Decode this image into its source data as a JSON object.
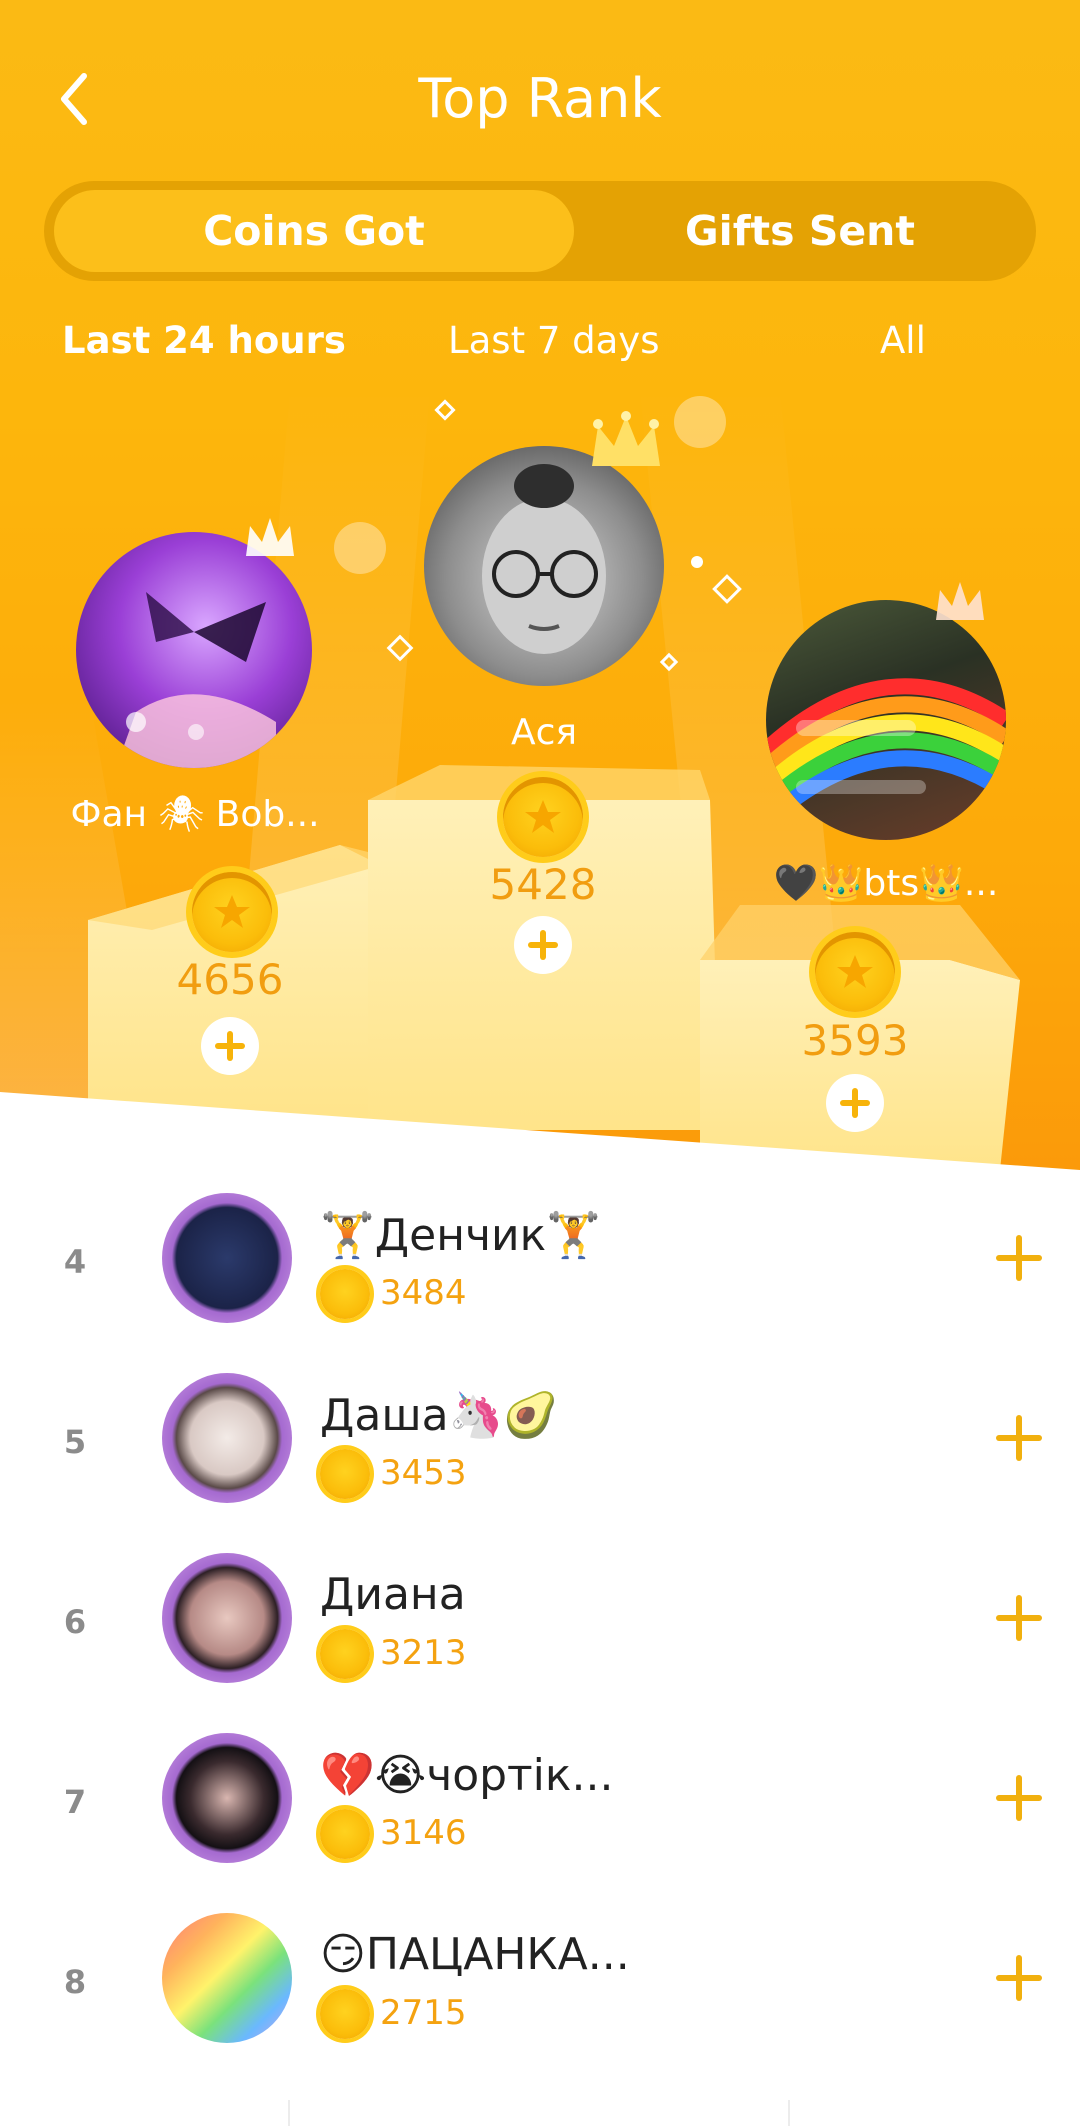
{
  "header": {
    "title": "Top Rank",
    "back_icon": "chevron-left-icon"
  },
  "segments": [
    {
      "label": "Coins Got",
      "active": true
    },
    {
      "label": "Gifts Sent",
      "active": false
    }
  ],
  "periods": [
    {
      "label": "Last 24 hours",
      "active": true
    },
    {
      "label": "Last 7 days",
      "active": false
    },
    {
      "label": "All",
      "active": false
    }
  ],
  "podium": {
    "first": {
      "name": "Ася",
      "score": "5428"
    },
    "second": {
      "name": "Фан 🕷 Bob...",
      "score": "4656"
    },
    "third": {
      "name": "🖤👑bts👑...",
      "score": "3593"
    }
  },
  "list": [
    {
      "rank": "4",
      "name": "🏋️Денчик🏋️",
      "score": "3484"
    },
    {
      "rank": "5",
      "name": "Даша🦄🥑",
      "score": "3453"
    },
    {
      "rank": "6",
      "name": "Диана",
      "score": "3213"
    },
    {
      "rank": "7",
      "name": "💔😭чортік...",
      "score": "3146"
    },
    {
      "rank": "8",
      "name": "😏ПАЦАНКА...",
      "score": "2715"
    }
  ],
  "colors": {
    "brand": "#fbba14",
    "score": "#f4a210",
    "plus": "#f1b00e"
  }
}
